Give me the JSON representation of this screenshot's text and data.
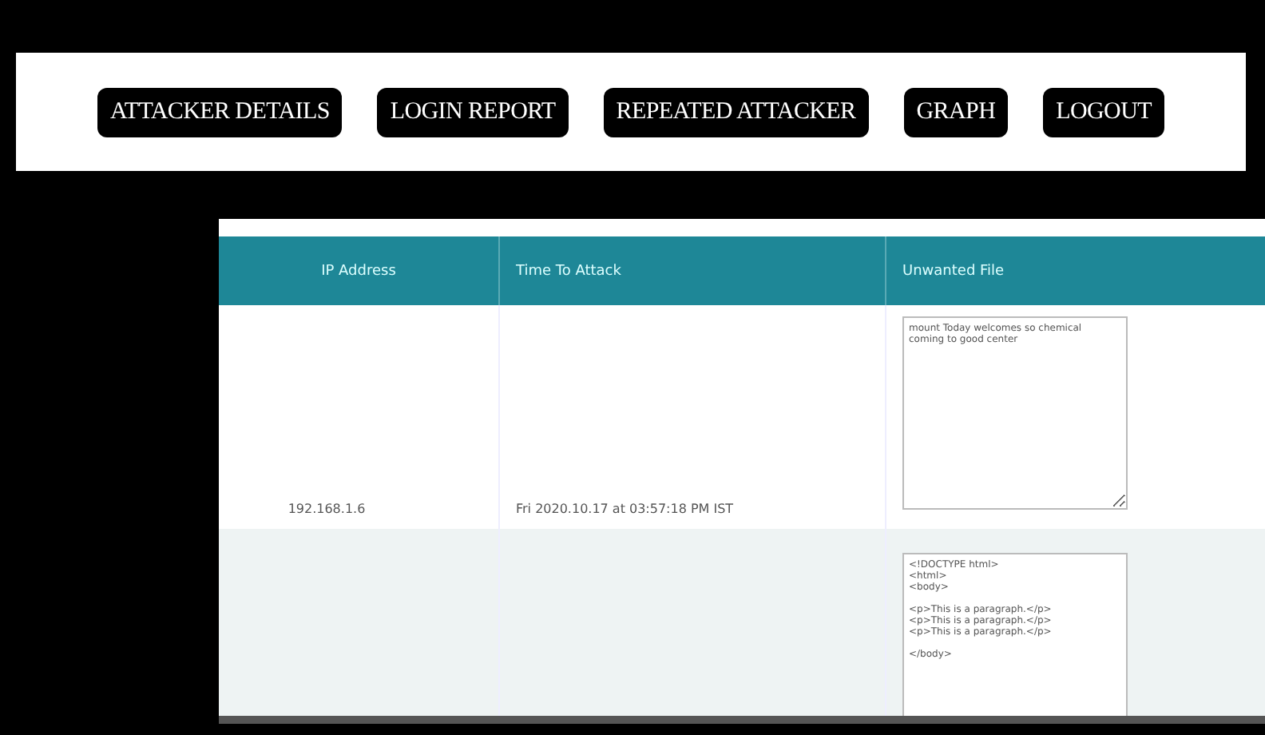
{
  "nav": {
    "buttons": [
      "ATTACKER DETAILS",
      "LOGIN REPORT",
      "REPEATED ATTACKER",
      "GRAPH",
      "LOGOUT"
    ]
  },
  "table": {
    "columns": [
      "IP Address",
      "Time To Attack",
      "Unwanted File"
    ],
    "rows": [
      {
        "ip": "192.168.1.6",
        "time": "Fri 2020.10.17 at 03:57:18 PM IST",
        "file": "mount Today welcomes so chemical\ncoming to good center"
      },
      {
        "file": "<!DOCTYPE html>\n<html>\n<body>\n\n<p>This is a paragraph.</p>\n<p>This is a paragraph.</p>\n<p>This is a paragraph.</p>\n\n</body>"
      }
    ]
  }
}
